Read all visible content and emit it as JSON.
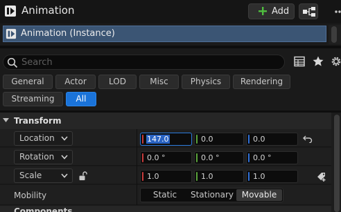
{
  "header": {
    "title": "Animation",
    "title_icon": "blueprint-component-icon",
    "add_label": "Add",
    "add_icon": "plus-icon",
    "blueprint_icon": "blueprint-hierarchy-icon",
    "more_icon": "more-icon"
  },
  "component": {
    "label": "Animation (Instance)",
    "icon": "blueprint-component-icon",
    "accent_color": "#3b5574"
  },
  "search": {
    "placeholder": "Search",
    "value": "",
    "icons": [
      "table-view-icon",
      "favorite-star-icon",
      "settings-gear-icon"
    ]
  },
  "filters": {
    "items": [
      {
        "label": "General",
        "active": false
      },
      {
        "label": "Actor",
        "active": false
      },
      {
        "label": "LOD",
        "active": false
      },
      {
        "label": "Misc",
        "active": false
      },
      {
        "label": "Physics",
        "active": false
      },
      {
        "label": "Rendering",
        "active": false
      },
      {
        "label": "Streaming",
        "active": false
      },
      {
        "label": "All",
        "active": true
      }
    ],
    "active_color": "#1a73d9"
  },
  "transform": {
    "title": "Transform",
    "rows": [
      {
        "label": "Location",
        "values": [
          "147.0",
          "0.0",
          "0.0"
        ],
        "editing_index": 0
      },
      {
        "label": "Rotation",
        "values": [
          "0.0 °",
          "0.0 °",
          "0.0 °"
        ]
      },
      {
        "label": "Scale",
        "values": [
          "1.0",
          "1.0",
          "1.0"
        ]
      }
    ],
    "axis_colors": [
      "#c83a3a",
      "#5aa33a",
      "#2f6fd6"
    ],
    "mobility": {
      "label": "Mobility",
      "options": [
        "Static",
        "Stationary",
        "Movable"
      ],
      "selected": "Movable"
    }
  },
  "next_section": {
    "title": "Components"
  }
}
